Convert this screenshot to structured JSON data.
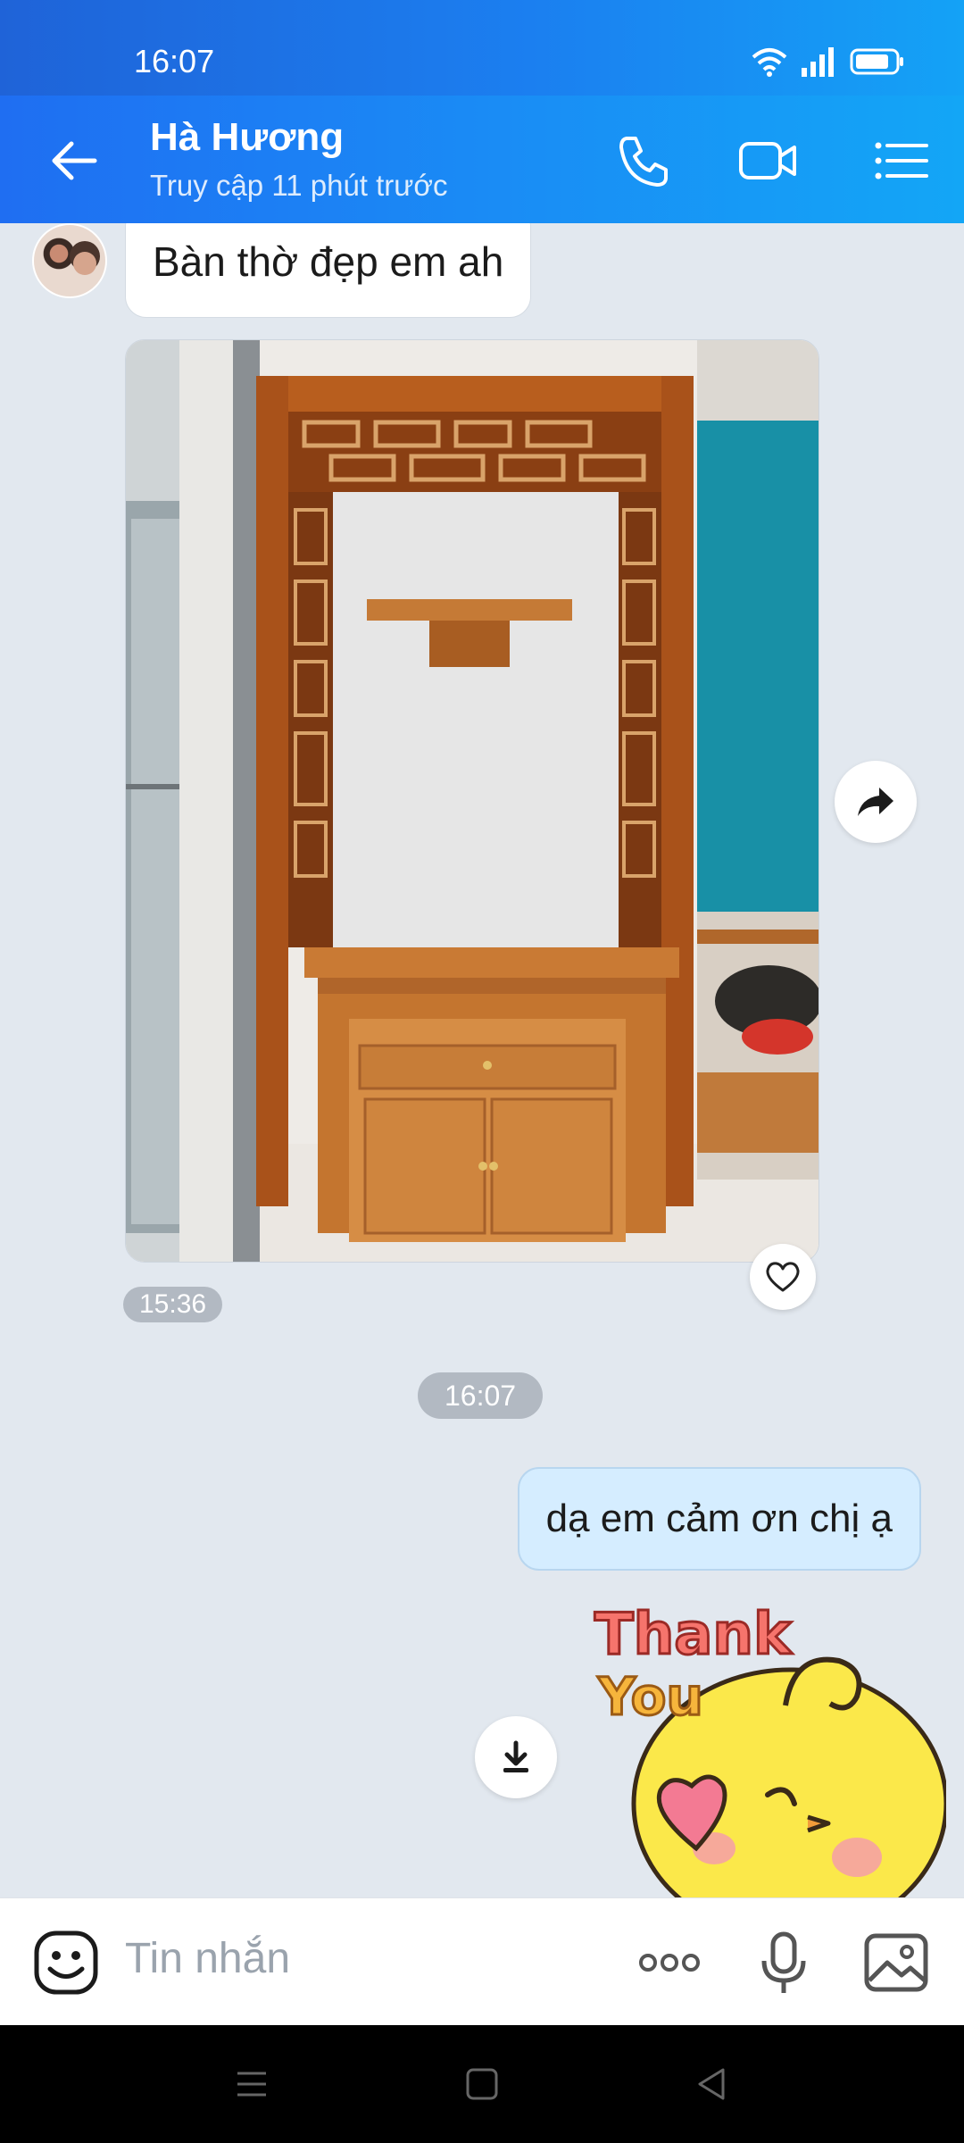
{
  "status_bar": {
    "time": "16:07"
  },
  "header": {
    "name": "Hà Hương",
    "status": "Truy cập 11 phút trước"
  },
  "messages": {
    "incoming_text": "Bàn thờ đẹp em ah",
    "incoming_time": "15:36",
    "divider_time": "16:07",
    "outgoing_text": "dạ em cảm ơn chị ạ",
    "sticker_text_line1": "Thank",
    "sticker_text_line2": "You"
  },
  "input": {
    "placeholder": "Tin nhắn"
  },
  "colors": {
    "header_start": "#1f6ef2",
    "header_end": "#13a6f6",
    "chat_bg": "#e2e8ef",
    "outgoing_bubble": "#d5edff"
  }
}
